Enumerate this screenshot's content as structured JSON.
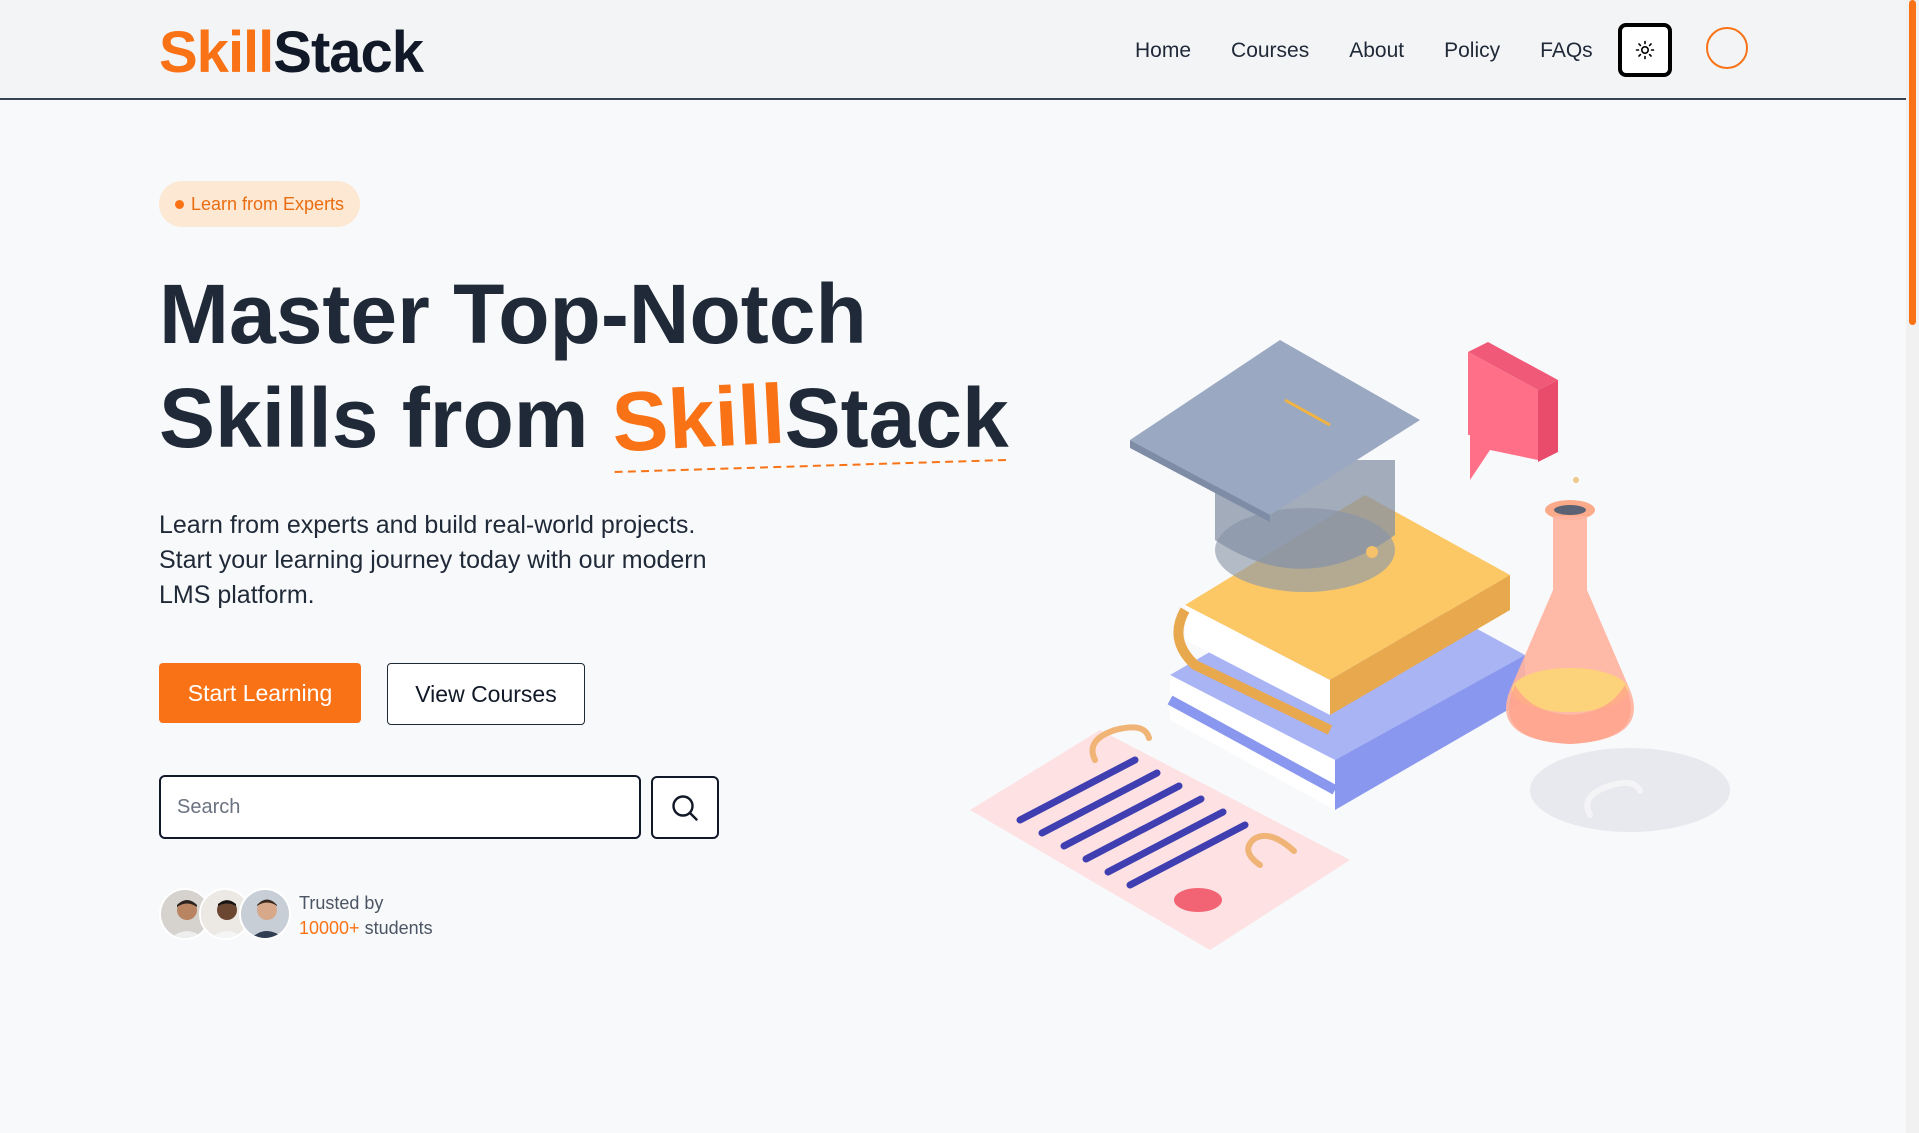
{
  "brand": {
    "part1": "Skill",
    "part2": "Stack",
    "accent": "#f97316"
  },
  "nav": {
    "items": [
      "Home",
      "Courses",
      "About",
      "Policy",
      "FAQs"
    ]
  },
  "header": {
    "theme_icon": "sun-icon",
    "profile_icon": "user-avatar"
  },
  "hero": {
    "badge": "Learn from Experts",
    "headline_line1": "Master Top-Notch",
    "headline_line2_prefix": "Skills from ",
    "subtitle_line1": "Learn from experts and build real-world projects.",
    "subtitle_line2": "Start your learning journey today with our modern",
    "subtitle_line3": "LMS platform.",
    "primary_button": "Start Learning",
    "secondary_button": "View Courses"
  },
  "search": {
    "placeholder": "Search",
    "value": "",
    "icon": "search-icon"
  },
  "trust": {
    "label": "Trusted by",
    "count": "10000+",
    "suffix": " students"
  },
  "colors": {
    "primary": "#f97316",
    "text": "#1f2937",
    "background": "#f8f9fb"
  }
}
